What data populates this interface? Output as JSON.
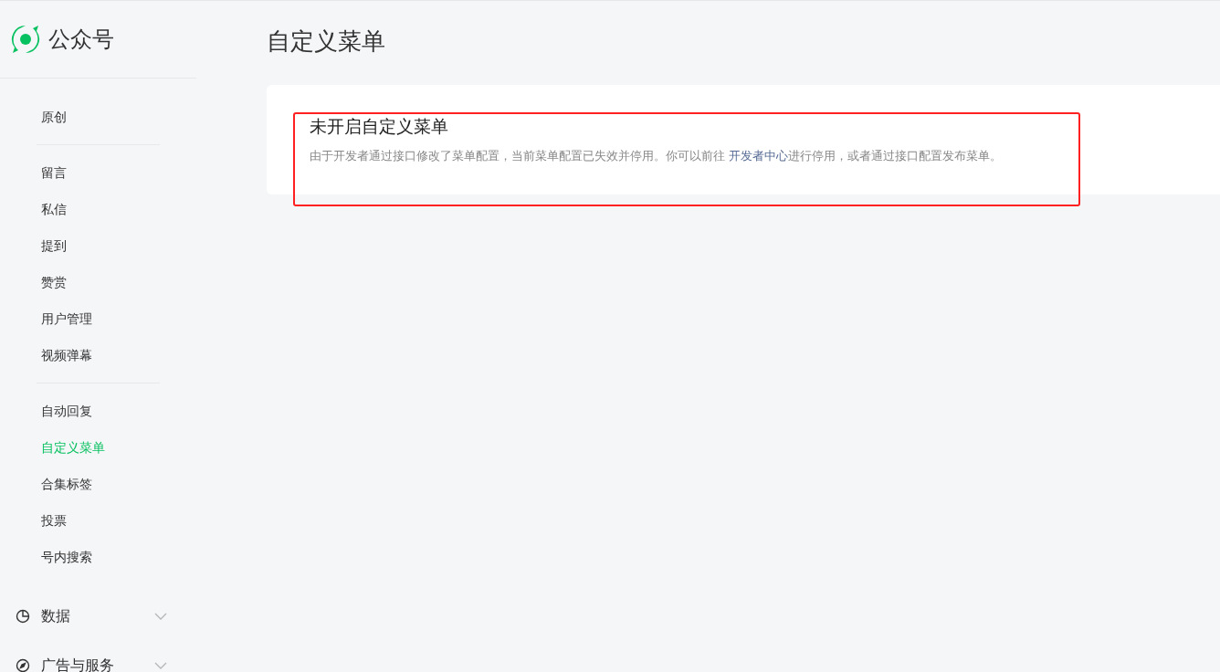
{
  "app": {
    "name": "公众号"
  },
  "sidebar": {
    "groups": [
      {
        "items": [
          {
            "label": "原创",
            "selected": false
          }
        ]
      },
      {
        "items": [
          {
            "label": "留言",
            "selected": false
          },
          {
            "label": "私信",
            "selected": false
          },
          {
            "label": "提到",
            "selected": false
          },
          {
            "label": "赞赏",
            "selected": false
          },
          {
            "label": "用户管理",
            "selected": false
          },
          {
            "label": "视频弹幕",
            "selected": false
          }
        ]
      },
      {
        "items": [
          {
            "label": "自动回复",
            "selected": false
          },
          {
            "label": "自定义菜单",
            "selected": true
          },
          {
            "label": "合集标签",
            "selected": false
          },
          {
            "label": "投票",
            "selected": false
          },
          {
            "label": "号内搜索",
            "selected": false
          }
        ]
      }
    ],
    "sections": [
      {
        "label": "数据",
        "kind": "chart",
        "expanded": false
      },
      {
        "label": "广告与服务",
        "kind": "compass",
        "expanded": false
      }
    ]
  },
  "page": {
    "title": "自定义菜单",
    "notice": {
      "title": "未开启自定义菜单",
      "text_before": "由于开发者通过接口修改了菜单配置，当前菜单配置已失效并停用。你可以前往 ",
      "link": "开发者中心",
      "text_after": "进行停用，或者通过接口配置发布菜单。"
    }
  }
}
